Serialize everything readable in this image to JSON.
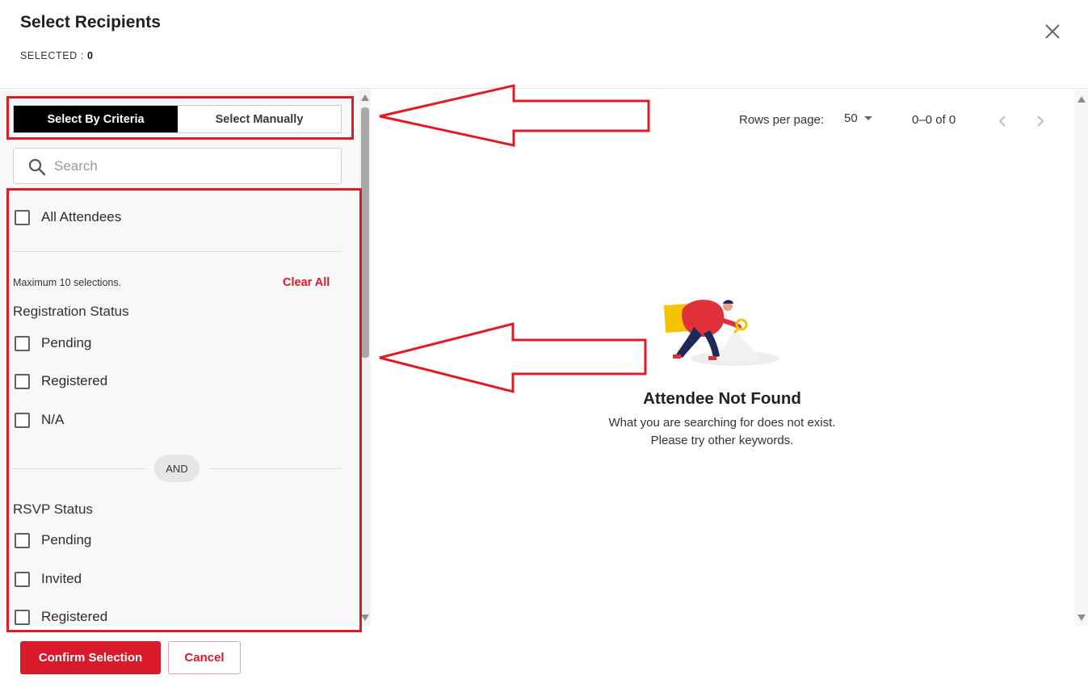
{
  "header": {
    "title": "Select Recipients",
    "selected_label": "SELECTED : ",
    "selected_count": "0"
  },
  "icons": {
    "close": "close-icon",
    "search": "search-icon",
    "dropdown": "caret-down-icon",
    "prev": "chevron-left-icon",
    "next": "chevron-right-icon",
    "empty_state": "person-with-magnifier-illustration"
  },
  "left": {
    "tabs": [
      {
        "label": "Select By Criteria",
        "active": true
      },
      {
        "label": "Select Manually",
        "active": false
      }
    ],
    "search": {
      "placeholder": "Search",
      "value": ""
    },
    "all_attendees": {
      "label": "All Attendees",
      "checked": false
    },
    "max_note": "Maximum 10 selections.",
    "clear_all": "Clear All",
    "registration_status": {
      "title": "Registration Status",
      "options": [
        {
          "label": "Pending",
          "checked": false
        },
        {
          "label": "Registered",
          "checked": false
        },
        {
          "label": "N/A",
          "checked": false
        }
      ]
    },
    "and_label": "AND",
    "rsvp_status": {
      "title": "RSVP Status",
      "options": [
        {
          "label": "Pending",
          "checked": false
        },
        {
          "label": "Invited",
          "checked": false
        },
        {
          "label": "Registered",
          "checked": false
        }
      ]
    }
  },
  "right": {
    "rows_per_page_label": "Rows per page:",
    "rows_per_page_value": "50",
    "range_text": "0–0 of 0",
    "empty_title": "Attendee Not Found",
    "empty_line1": "What you are searching for does not exist.",
    "empty_line2": "Please try other keywords."
  },
  "footer": {
    "confirm_label": "Confirm Selection",
    "cancel_label": "Cancel"
  },
  "colors": {
    "accent": "#d91a2a",
    "annotation": "#e01b24",
    "active_tab": "#000000"
  }
}
